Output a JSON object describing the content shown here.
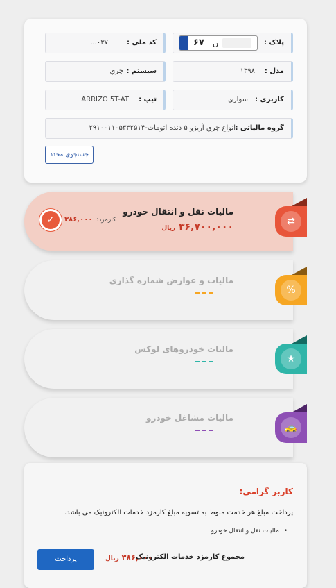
{
  "vehicle": {
    "plate_label": "پلاک :",
    "plate_number": "۶۷",
    "plate_letter": "ن",
    "national_code_label": "کد ملی :",
    "national_code_value": "۰۳۷...",
    "model_label": "مدل :",
    "model_value": "۱۳۹۸",
    "system_label": "سیستم :",
    "system_value": "چري",
    "usage_label": "کاربری :",
    "usage_value": "سواري",
    "type_label": "تیپ :",
    "type_value": "ARRIZO 5T-AT",
    "tax_group_label": "گروه مالیاتی :",
    "tax_group_value": "انواع چري آريزو ۵ دنده اتومات-۲۹۱۰۰۱۱۰۵۳۳۲۵۱۴",
    "retry_button": "جستجوی مجدد"
  },
  "services": [
    {
      "title": "مالیات نقل و انتقال خودرو",
      "amount": "۳۶,۷۰۰,۰۰۰",
      "currency": "ریال",
      "fee_label": "کارمزد:",
      "fee_value": "۳۸۶,۰۰۰",
      "color": "#e8553a",
      "dark": "#8a2a1a"
    },
    {
      "title": "مالیات و عوارض شماره گذاری",
      "color": "#f6a623",
      "dark": "#8a5a10"
    },
    {
      "title": "مالیات خودروهای لوکس",
      "color": "#2fb5a8",
      "dark": "#136b62"
    },
    {
      "title": "مالیات مشاغل خودرو",
      "color": "#8e4fb5",
      "dark": "#4e2468"
    }
  ],
  "info": {
    "dear": "کاربر گرامی:",
    "message": "پرداخت مبلغ هر خدمت منوط به تسویه مبلغ کارمزد خدمات الکترونیک می باشد.",
    "item": "مالیات نقل و انتقال خودرو",
    "total_label": "مجموع کارمزد خدمات الکترونیک",
    "total_value": "۳۸۶,۰۰۰",
    "total_currency": "ریال",
    "pay_button": "پرداخت"
  }
}
